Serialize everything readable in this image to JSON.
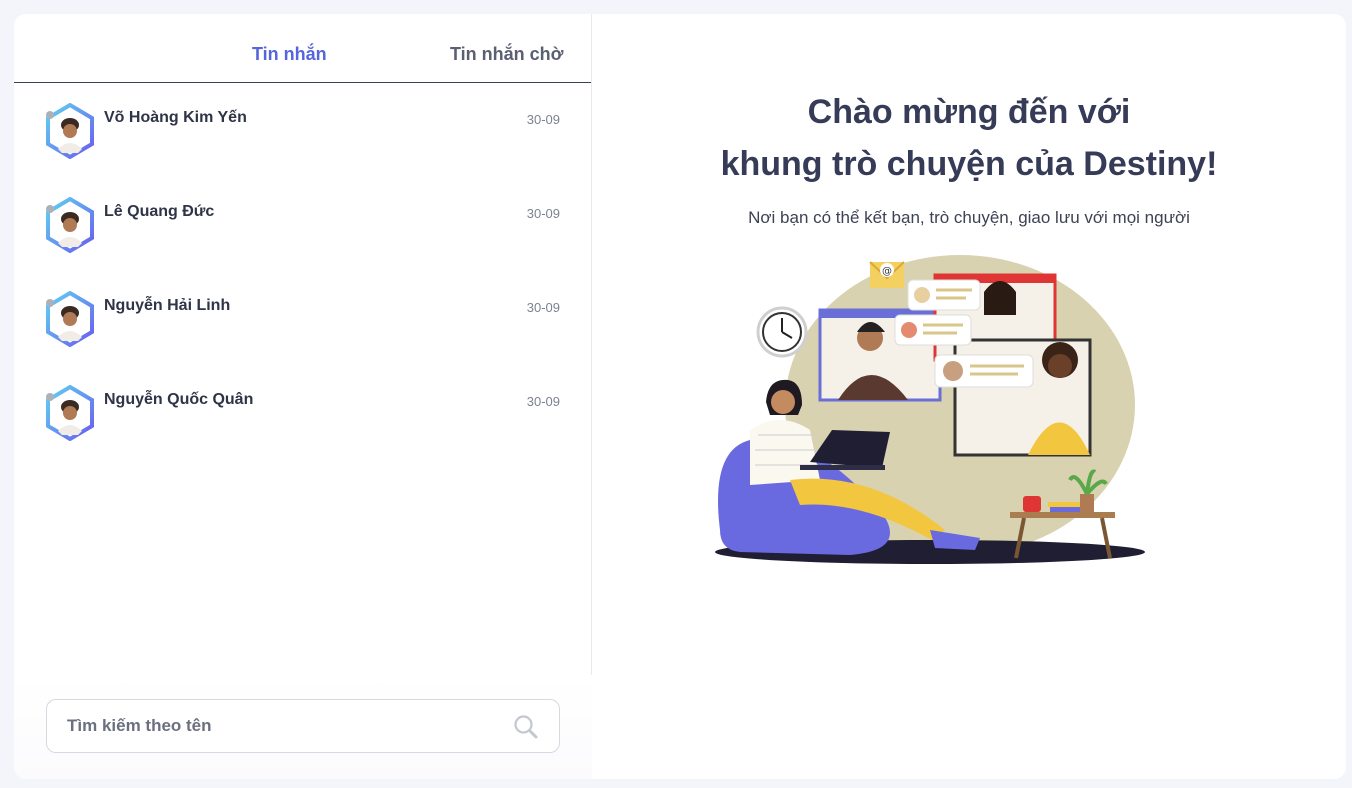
{
  "tabs": {
    "messages": "Tin nhắn",
    "pending": "Tin nhắn chờ"
  },
  "conversations": [
    {
      "name": "Võ Hoàng Kim Yến",
      "date": "30-09"
    },
    {
      "name": "Lê Quang Đức",
      "date": "30-09"
    },
    {
      "name": "Nguyễn Hải Linh",
      "date": "30-09"
    },
    {
      "name": "Nguyễn Quốc Quân",
      "date": "30-09"
    }
  ],
  "search": {
    "placeholder": "Tìm kiếm theo tên"
  },
  "welcome": {
    "title_line1": "Chào mừng đến với",
    "title_line2": "khung trò chuyện của Destiny!",
    "subtitle": "Nơi bạn có thể kết bạn, trò chuyện, giao lưu với mọi người"
  },
  "colors": {
    "accent": "#5566dd",
    "text_dark": "#363b57",
    "status_offline": "#aeb0b8"
  },
  "icons": {
    "search": "search-icon",
    "avatar": "avatar-icon",
    "illustration": "video-chat-illustration"
  }
}
